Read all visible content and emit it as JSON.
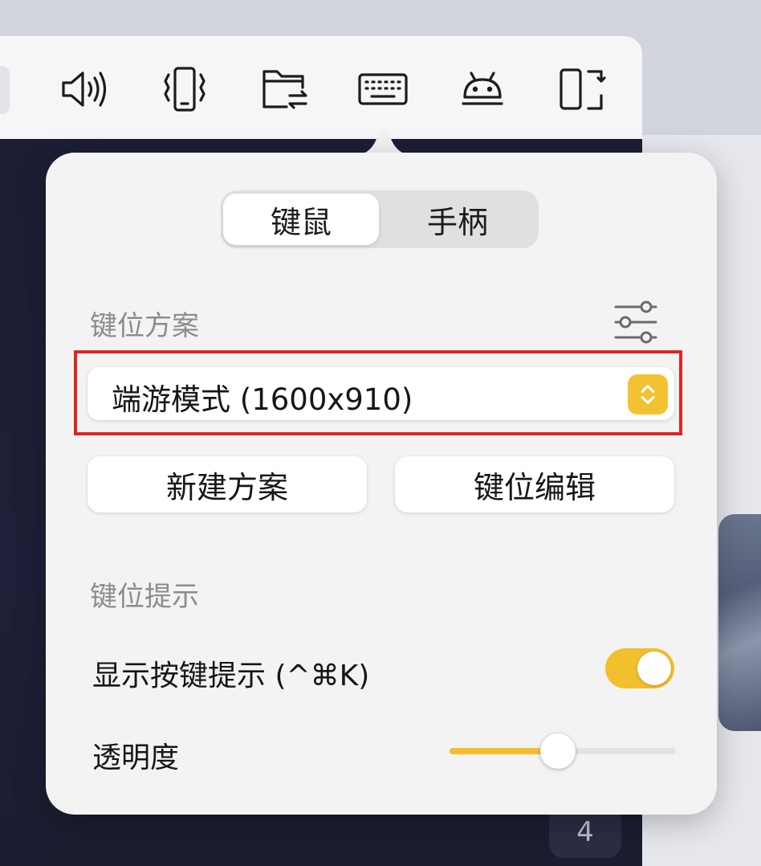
{
  "toolbar": {
    "icons": [
      "speaker-icon",
      "shake-phone-icon",
      "folder-transfer-icon",
      "keyboard-icon",
      "android-icon",
      "rotate-screen-icon"
    ]
  },
  "background": {
    "page_number": "4"
  },
  "popover": {
    "segments": {
      "keyboard_mouse": "键鼠",
      "gamepad": "手柄",
      "selected": "键鼠"
    },
    "keymap_section_label": "键位方案",
    "keymap_select_value": "端游模式 (1600x910)",
    "new_scheme_button": "新建方案",
    "edit_keymap_button": "键位编辑",
    "hint_section_label": "键位提示",
    "show_hints_label": "显示按键提示 (^⌘K)",
    "show_hints_enabled": true,
    "opacity_label": "透明度",
    "opacity_value": 0.48,
    "colors": {
      "accent": "#f2bf2d",
      "highlight_border": "#e02420"
    }
  }
}
